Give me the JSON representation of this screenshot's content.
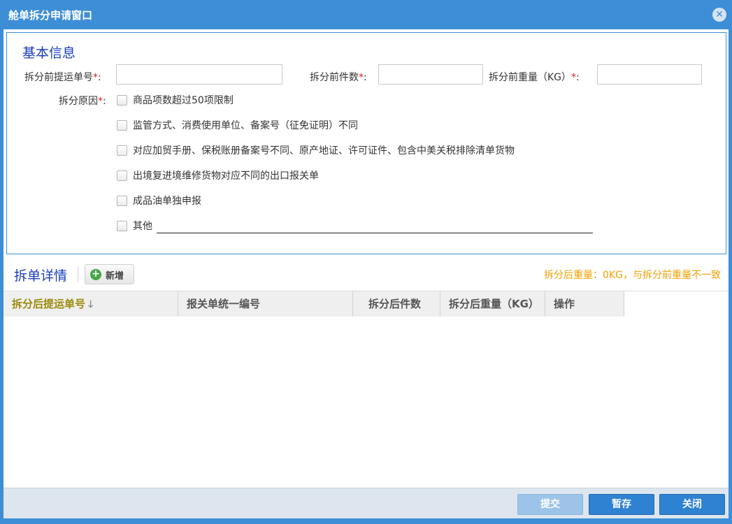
{
  "window": {
    "title": "舱单拆分申请窗口",
    "close_glyph": "✕"
  },
  "basic_info": {
    "section_title": "基本信息",
    "fields": {
      "bill_no": {
        "label": "拆分前提运单号",
        "required_mark": "*",
        "colon": ":",
        "value": ""
      },
      "pieces": {
        "label": "拆分前件数",
        "required_mark": "*",
        "colon": ":",
        "value": ""
      },
      "weight": {
        "label": "拆分前重量（KG）",
        "required_mark": "*",
        "colon": ":",
        "value": ""
      }
    },
    "reason": {
      "label": "拆分原因",
      "required_mark": "*",
      "colon": ":",
      "options": [
        {
          "label": "商品项数超过50项限制",
          "checked": false
        },
        {
          "label": "监管方式、消费使用单位、备案号（征免证明）不同",
          "checked": false
        },
        {
          "label": "对应加贸手册、保税账册备案号不同、原产地证、许可证件、包含中美关税排除清单货物",
          "checked": false
        },
        {
          "label": "出境复进境维修货物对应不同的出口报关单",
          "checked": false
        },
        {
          "label": "成品油单独申报",
          "checked": false
        },
        {
          "label": "其他",
          "checked": false
        }
      ]
    }
  },
  "detail": {
    "section_title": "拆单详情",
    "add_button": "新增",
    "add_icon": "+",
    "warning": "拆分后重量：0KG，与拆分前重量不一致",
    "columns": [
      {
        "label": "拆分后提运单号",
        "sort_arrow": "🡓"
      },
      {
        "label": "报关单统一编号"
      },
      {
        "label": "拆分后件数"
      },
      {
        "label": "拆分后重量（KG）"
      },
      {
        "label": "操作"
      }
    ],
    "rows": []
  },
  "footer": {
    "submit": "提交",
    "save": "暂存",
    "close": "关闭"
  },
  "colors": {
    "window_blue": "#3d8ed6",
    "section_title": "#1a3fb8",
    "warning": "#f0a000",
    "required": "#e02020",
    "sorted_header": "#9a8a0a"
  }
}
